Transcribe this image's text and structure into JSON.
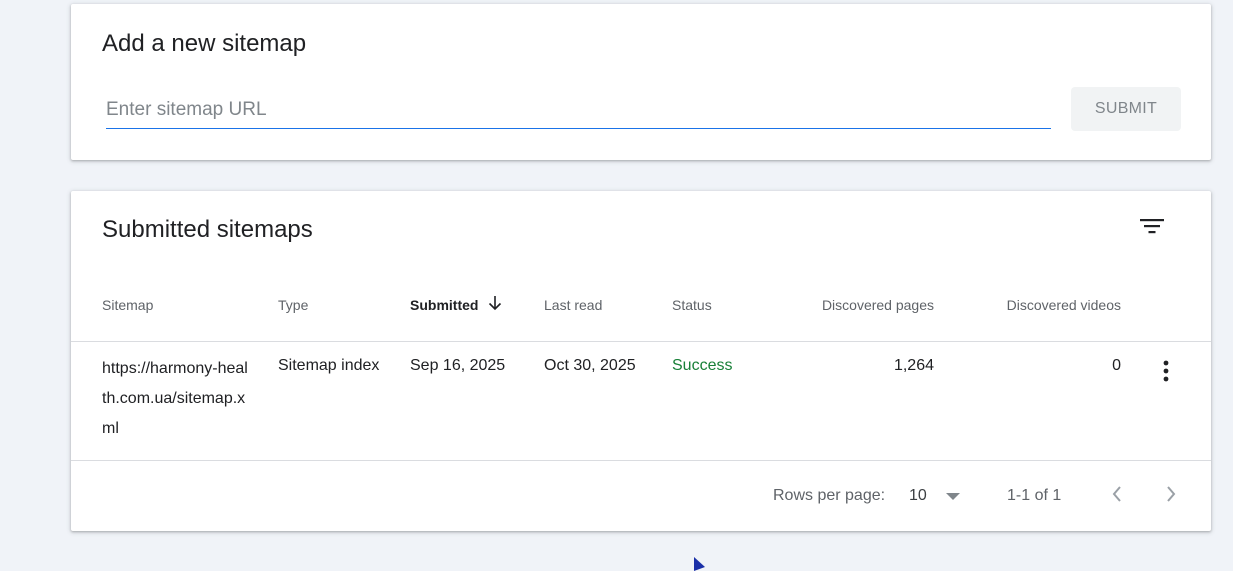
{
  "add_sitemap": {
    "title": "Add a new sitemap",
    "input_placeholder": "Enter sitemap URL",
    "input_value": "",
    "submit_label": "SUBMIT"
  },
  "submitted_sitemaps": {
    "title": "Submitted sitemaps",
    "filter_icon": "filter-icon",
    "columns": {
      "sitemap": "Sitemap",
      "type": "Type",
      "submitted": "Submitted",
      "last_read": "Last read",
      "status": "Status",
      "discovered_pages": "Discovered pages",
      "discovered_videos": "Discovered videos"
    },
    "sort_icon": "arrow-down-icon",
    "rows": [
      {
        "sitemap": "https://harmony-health.com.ua/sitemap.xml",
        "type": "Sitemap index",
        "submitted": "Sep 16, 2025",
        "last_read": "Oct 30, 2025",
        "status": "Success",
        "discovered_pages": "1,264",
        "discovered_videos": "0"
      }
    ],
    "footer": {
      "rows_per_page_label": "Rows per page:",
      "rows_per_page_value": "10",
      "range_label": "1-1 of 1"
    }
  },
  "colors": {
    "accent": "#1a73e8",
    "success": "#188038",
    "background": "#f0f3f8"
  }
}
